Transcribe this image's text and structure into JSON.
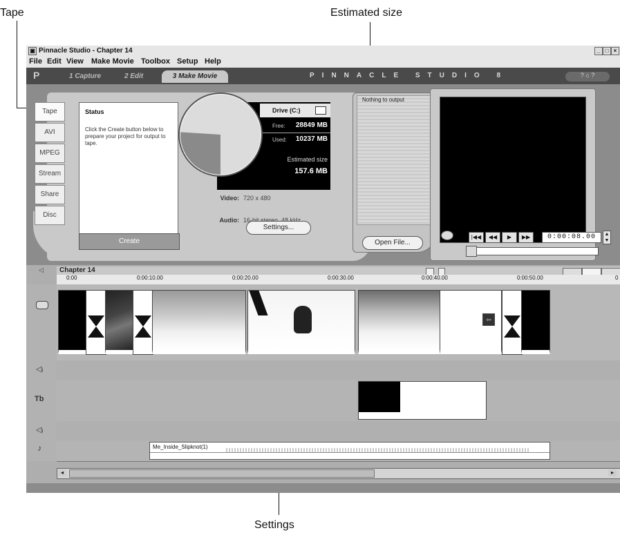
{
  "callouts": {
    "tape": "Tape",
    "estimated_size": "Estimated size",
    "settings": "Settings"
  },
  "window": {
    "title": "Pinnacle Studio - Chapter 14",
    "controls": [
      "minimize",
      "maximize",
      "close"
    ]
  },
  "menu": [
    "File",
    "Edit",
    "View",
    "Make Movie",
    "Toolbox",
    "Setup",
    "Help"
  ],
  "mode_tabs": [
    {
      "label": "1 Capture",
      "active": false
    },
    {
      "label": "2 Edit",
      "active": false
    },
    {
      "label": "3 Make Movie",
      "active": true
    }
  ],
  "brand": "PINNACLE STUDIO 8",
  "output_tabs": [
    "Tape",
    "AVI",
    "MPEG",
    "Stream",
    "Share",
    "Disc"
  ],
  "selected_output_tab": "Tape",
  "status": {
    "title": "Status",
    "message": "Click the Create button below to prepare your project for output to tape.",
    "create_label": "Create"
  },
  "drive": {
    "label": "Drive (C:)",
    "free_label": "Free:",
    "free_value": "28849 MB",
    "used_label": "Used:",
    "used_value": "10237 MB",
    "used_fraction": 0.26,
    "estimated_label": "Estimated size",
    "estimated_value": "157.6 MB"
  },
  "format": {
    "video_label": "Video:",
    "video_value": "720 x 480",
    "audio_label": "Audio:",
    "audio_value": "16-bit stereo, 48 kHz",
    "settings_label": "Settings..."
  },
  "output_list": {
    "empty_text": "Nothing to output",
    "open_file_label": "Open File..."
  },
  "player": {
    "timecode": "0:00:08.00",
    "buttons": [
      "go-to-start",
      "rewind",
      "play",
      "fast-forward"
    ]
  },
  "timeline": {
    "title": "Chapter 14",
    "ruler_ticks": [
      "0:00",
      "0:00:10.00",
      "0:00:20.00",
      "0:00:30.00",
      "0:00:40.00",
      "0:00:50.00",
      "0"
    ],
    "audio_clip_label": "Me_Inside_Slipknot(1)"
  },
  "colors": {
    "panel": "#c9c9c9",
    "dark_tabbar": "#4a4a4a",
    "pie_used": "#8a8a8a",
    "pie_free": "#dcdcdc"
  }
}
